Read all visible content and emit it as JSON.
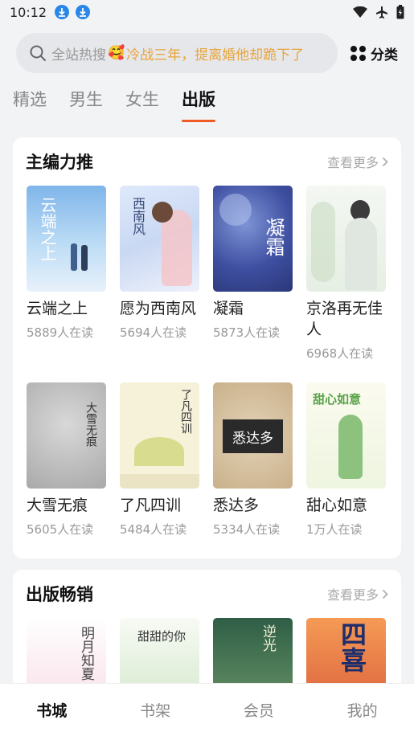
{
  "status": {
    "time": "10:12"
  },
  "search": {
    "placeholder": "全站热搜",
    "emoji": "🥰",
    "hot_query": "冷战三年，提离婚他却跪下了"
  },
  "header": {
    "category_label": "分类"
  },
  "tabs": [
    {
      "label": "精选",
      "active": false
    },
    {
      "label": "男生",
      "active": false
    },
    {
      "label": "女生",
      "active": false
    },
    {
      "label": "出版",
      "active": true
    }
  ],
  "sections": {
    "featured": {
      "title": "主编力推",
      "more": "查看更多",
      "row1": [
        {
          "title": "云端之上",
          "readers": "5889人在读",
          "cover_text": "云端之上"
        },
        {
          "title": "愿为西南风",
          "readers": "5694人在读",
          "cover_text": "西南风"
        },
        {
          "title": "凝霜",
          "readers": "5873人在读",
          "cover_text": "凝霜"
        },
        {
          "title": "京洛再无佳人",
          "readers": "6968人在读",
          "cover_text": ""
        }
      ],
      "row2": [
        {
          "title": "大雪无痕",
          "readers": "5605人在读",
          "cover_text": "大雪无痕"
        },
        {
          "title": "了凡四训",
          "readers": "5484人在读",
          "cover_text": "了凡四训"
        },
        {
          "title": "悉达多",
          "readers": "5334人在读",
          "cover_text": "悉达多"
        },
        {
          "title": "甜心如意",
          "readers": "1万人在读",
          "cover_text": "甜心如意"
        }
      ]
    },
    "bestseller": {
      "title": "出版畅销",
      "more": "查看更多",
      "covers": [
        "明月知夏",
        "甜甜的你",
        "逆光",
        "四喜"
      ]
    }
  },
  "bottom_nav": [
    {
      "label": "书城",
      "active": true
    },
    {
      "label": "书架",
      "active": false
    },
    {
      "label": "会员",
      "active": false
    },
    {
      "label": "我的",
      "active": false
    }
  ]
}
